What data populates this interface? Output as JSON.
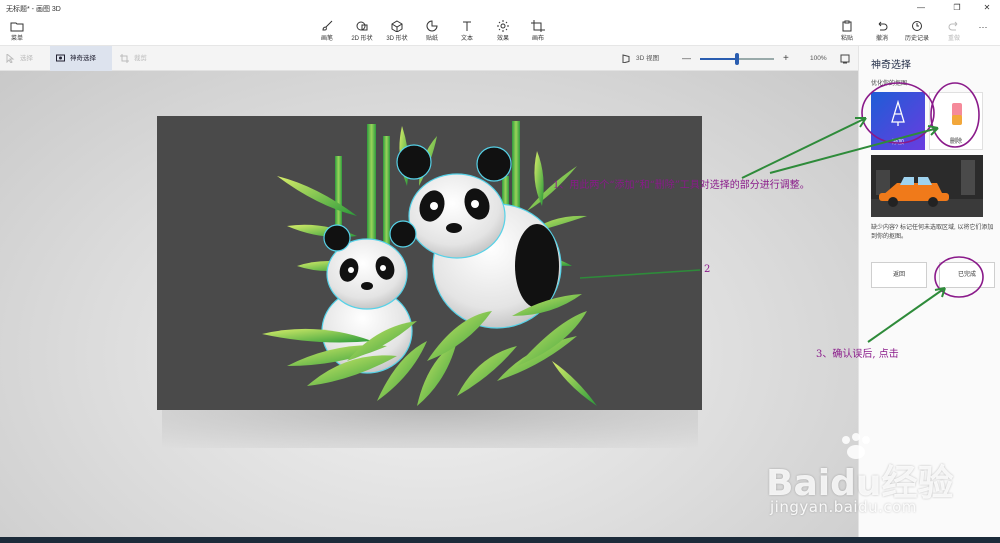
{
  "window": {
    "title": "无标题* - 画图 3D",
    "minimize": "—",
    "restore": "❐",
    "close": "✕"
  },
  "ribbon": {
    "menu": "菜单",
    "brushes": "画笔",
    "shapes2d": "2D 形状",
    "shapes3d": "3D 形状",
    "stickers": "贴纸",
    "text": "文本",
    "effects": "效果",
    "canvas": "画布",
    "paste": "粘贴",
    "undo": "撤消",
    "history": "历史记录",
    "redo": "重做",
    "more": "···"
  },
  "subbar": {
    "select": "选择",
    "magic_select": "神奇选择",
    "crop": "裁剪",
    "view3d": "3D 视图",
    "zoom_out": "—",
    "zoom_in": "+",
    "zoom_percent": "100%",
    "zoom_level": 0.5
  },
  "panel": {
    "title": "神奇选择",
    "subtitle": "优化你的抠图",
    "add_label": "添加",
    "remove_label": "删除",
    "hint": "缺少内容? 标记任何未选取区域, 以将它们添加到你的抠图。",
    "back_button": "返回",
    "done_button": "已完成"
  },
  "annotations": {
    "step1": "1、用此两个“添加”和“删除”工具对选择的部分进行调整。",
    "step2": "2",
    "step3": "3、确认误后, 点击",
    "color": "#8a1a8a",
    "arrow_color": "#2e8b3a"
  },
  "watermark": {
    "brand": "Baidu经验",
    "url": "jingyan.baidu.com"
  },
  "colors": {
    "canvas_bg": "#4a4a4a",
    "bamboo_green": "#7ac143",
    "selection_glow": "#56d2e8",
    "panel_bg": "#fafafa",
    "active_tab": "#dde3ee"
  }
}
